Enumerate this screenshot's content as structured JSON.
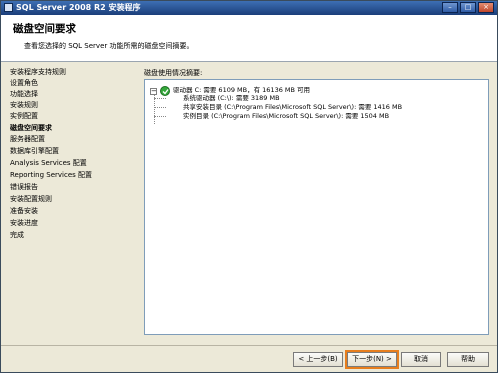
{
  "window": {
    "title": "SQL Server 2008 R2 安装程序",
    "buttons": [
      "–",
      "□",
      "×"
    ]
  },
  "header": {
    "title": "磁盘空间要求",
    "subtitle": "查看您选择的 SQL Server 功能所需的磁盘空间摘要。"
  },
  "nav": {
    "items": [
      {
        "label": "安装程序支持规则",
        "active": false
      },
      {
        "label": "设置角色",
        "active": false
      },
      {
        "label": "功能选择",
        "active": false
      },
      {
        "label": "安装规则",
        "active": false
      },
      {
        "label": "实例配置",
        "active": false
      },
      {
        "label": "磁盘空间要求",
        "active": true
      },
      {
        "label": "服务器配置",
        "active": false
      },
      {
        "label": "数据库引擎配置",
        "active": false
      },
      {
        "label": "Analysis Services 配置",
        "active": false
      },
      {
        "label": "Reporting Services 配置",
        "active": false
      },
      {
        "label": "错误报告",
        "active": false
      },
      {
        "label": "安装配置规则",
        "active": false
      },
      {
        "label": "准备安装",
        "active": false
      },
      {
        "label": "安装进度",
        "active": false
      },
      {
        "label": "完成",
        "active": false
      }
    ]
  },
  "content": {
    "label": "磁盘使用情况摘要:",
    "tree": {
      "expander": "−",
      "root": "驱动器 C: 需要 6109 MB，有 16136 MB 可用",
      "children": [
        "系统驱动器 (C:\\): 需要 3189 MB",
        "共享安装目录 (C:\\Program Files\\Microsoft SQL Server\\): 需要 1416 MB",
        "实例目录 (C:\\Program Files\\Microsoft SQL Server\\): 需要 1504 MB"
      ]
    }
  },
  "footer": {
    "back": "< 上一步(B)",
    "next": "下一步(N) >",
    "cancel": "取消",
    "help": "帮助"
  },
  "colors": {
    "title_bar": "#1b3e7a",
    "check": "#34a83a",
    "focus_outline": "#e77e1e"
  }
}
